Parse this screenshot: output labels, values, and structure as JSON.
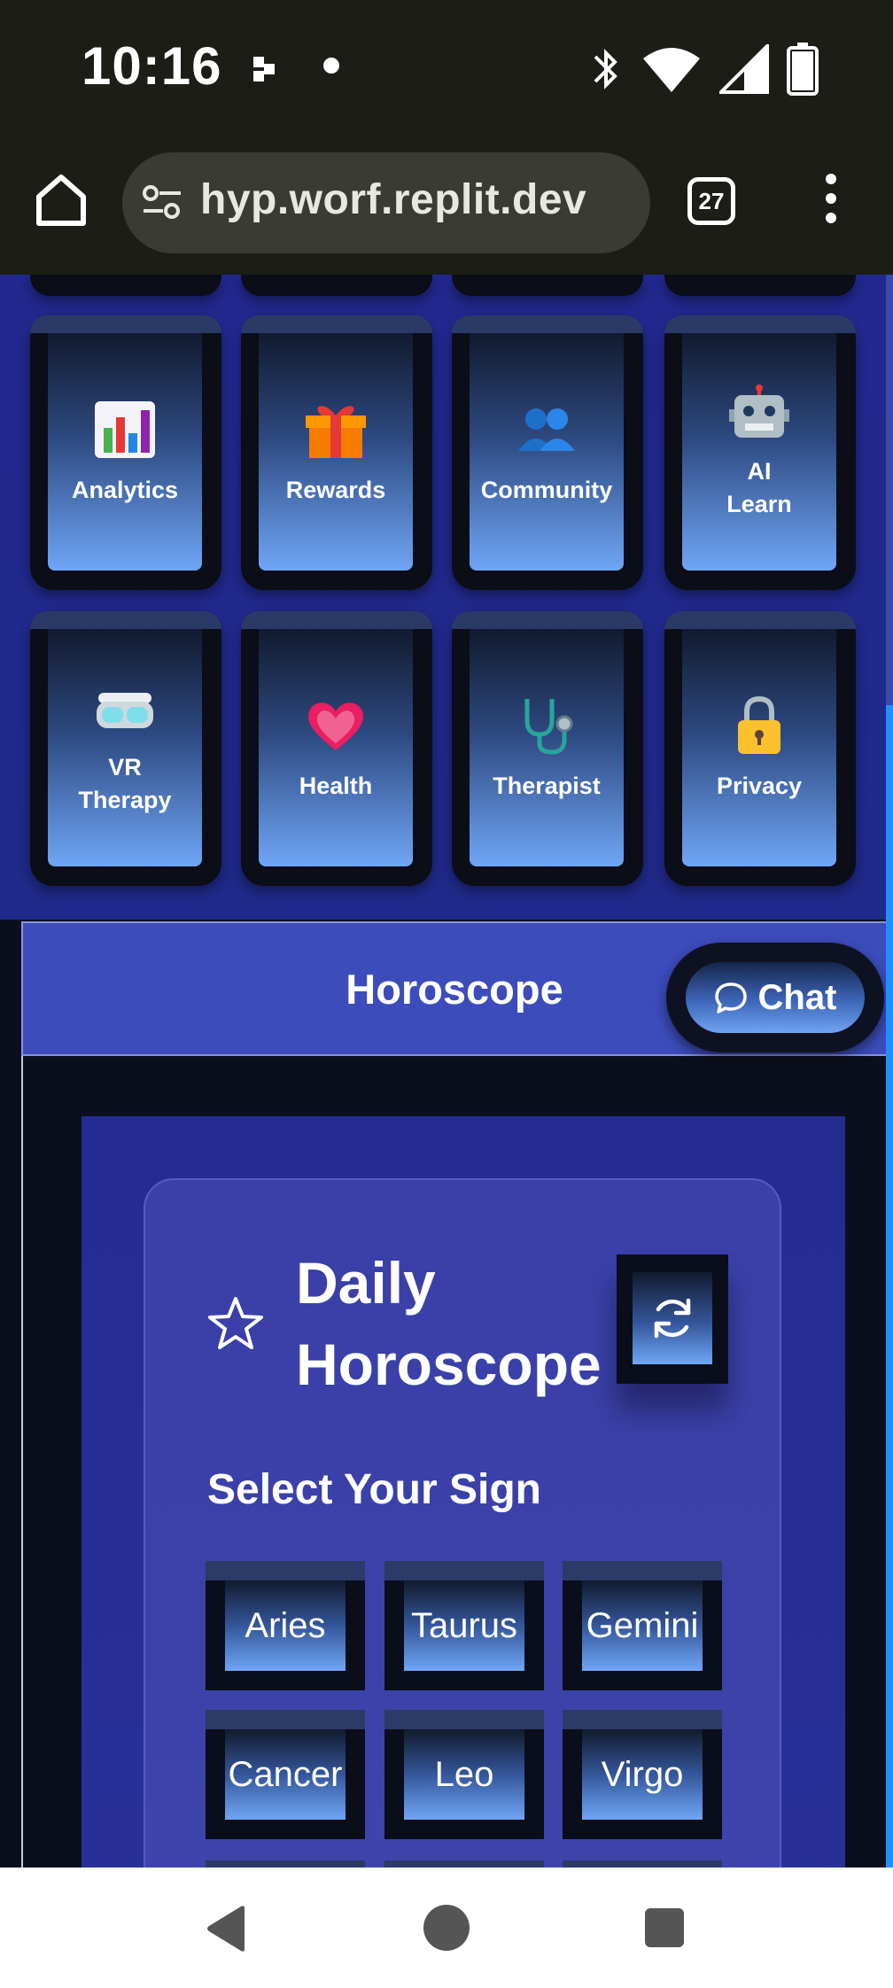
{
  "status_bar": {
    "time": "10:16"
  },
  "browser": {
    "url": "hyp.worf.replit.dev",
    "tab_count": "27"
  },
  "apps": [
    {
      "label": "Analytics",
      "icon": "bar-chart-icon"
    },
    {
      "label": "Rewards",
      "icon": "gift-icon"
    },
    {
      "label": "Community",
      "icon": "people-icon"
    },
    {
      "label": "AI\nLearn",
      "icon": "robot-icon"
    },
    {
      "label": "VR\nTherapy",
      "icon": "vr-goggles-icon"
    },
    {
      "label": "Health",
      "icon": "heart-icon"
    },
    {
      "label": "Therapist",
      "icon": "stethoscope-icon"
    },
    {
      "label": "Privacy",
      "icon": "lock-icon"
    }
  ],
  "header": {
    "title": "Horoscope"
  },
  "chat": {
    "label": "Chat"
  },
  "horoscope": {
    "title": "Daily Horoscope",
    "select_label": "Select Your Sign",
    "signs": [
      "Aries",
      "Taurus",
      "Gemini",
      "Cancer",
      "Leo",
      "Virgo"
    ]
  },
  "colors": {
    "apps_bg": "#22288e",
    "header_bg": "#3c4cbb",
    "tile_gradient_end": "#6fa6f6",
    "card_bg": "#3a40a8"
  }
}
